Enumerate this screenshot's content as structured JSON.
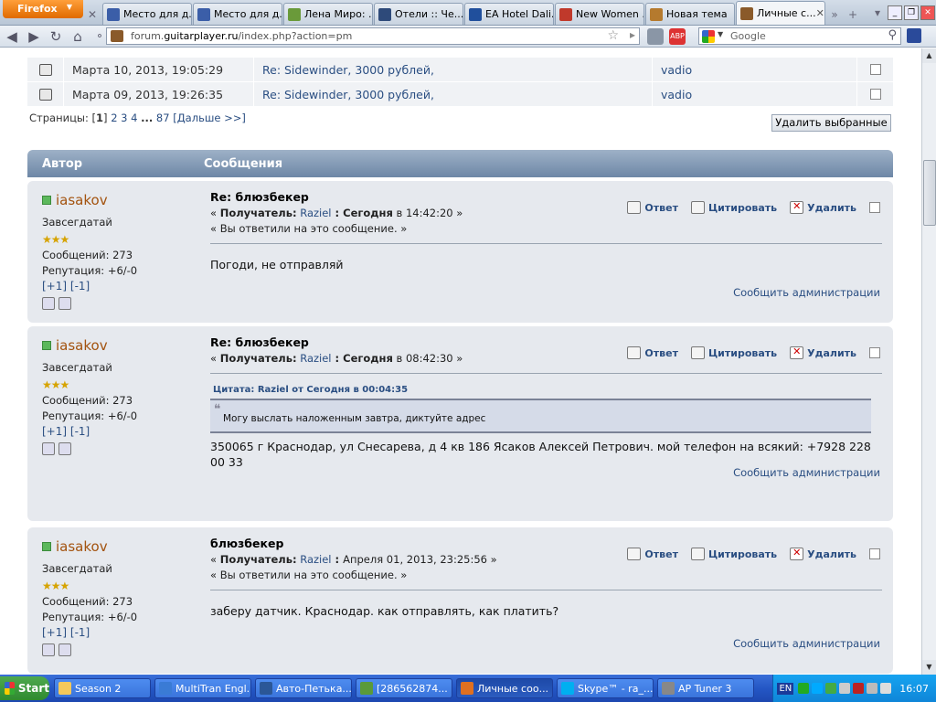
{
  "browser": {
    "app_label": "Firefox",
    "tabs": [
      {
        "label": "Место для д...",
        "color": "#3b5ea8"
      },
      {
        "label": "Место для д...",
        "color": "#3b5ea8"
      },
      {
        "label": "Лена Миро: ...",
        "color": "#6a9a3a"
      },
      {
        "label": "Отели :: Че...",
        "color": "#2e4a7a"
      },
      {
        "label": "EA Hotel Dali...",
        "color": "#204f9c"
      },
      {
        "label": "New Women ...",
        "color": "#c0392b"
      },
      {
        "label": "Новая тема",
        "color": "#b57a2e"
      },
      {
        "label": "Личные с...",
        "color": "#8a5a2a",
        "active": true
      }
    ],
    "url_prefix": "forum.",
    "url_domain": "guitarplayer.ru",
    "url_path": "/index.php?action=pm",
    "search_placeholder": "Google"
  },
  "pm_rows": [
    {
      "date": "Марта 10, 2013, 19:05:29",
      "subject": "Re: Sidewinder, 3000 рублей,",
      "author": "vadio"
    },
    {
      "date": "Марта 09, 2013, 19:26:35",
      "subject": "Re: Sidewinder, 3000 рублей,",
      "author": "vadio"
    }
  ],
  "pager": {
    "prefix": "Страницы:",
    "current": "1",
    "pages": [
      "2",
      "3",
      "4"
    ],
    "ellipsis": "...",
    "last": "87",
    "next": "[Дальше >>]"
  },
  "delete_selected": "Удалить выбранные",
  "table_header": {
    "author": "Автор",
    "messages": "Сообщения"
  },
  "actions": {
    "reply": "Ответ",
    "quote": "Цитировать",
    "delete": "Удалить"
  },
  "report_text": "Сообщить администрации",
  "posts": [
    {
      "author": "iasakov",
      "rank": "Завсегдатай",
      "stars": "★★★",
      "messages": "Сообщений: 273",
      "reputation": "Репутация: +6/-0",
      "rep_plus": "[+1]",
      "rep_minus": "[-1]",
      "title": "Re: блюзбекер",
      "meta_open": "« ",
      "recipient_label": "Получатель:",
      "recipient": "Raziel",
      "sep": " : ",
      "date_bold": "Сегодня",
      "date_rest": " в 14:42:20 »",
      "replied": "« Вы ответили на это сообщение. »",
      "text": "Погоди, не отправляй"
    },
    {
      "author": "iasakov",
      "rank": "Завсегдатай",
      "stars": "★★★",
      "messages": "Сообщений: 273",
      "reputation": "Репутация: +6/-0",
      "rep_plus": "[+1]",
      "rep_minus": "[-1]",
      "title": "Re: блюзбекер",
      "meta_open": "« ",
      "recipient_label": "Получатель:",
      "recipient": "Raziel",
      "sep": " : ",
      "date_bold": "Сегодня",
      "date_rest": " в 08:42:30 »",
      "quote_header": "Цитата: Raziel от Сегодня в 00:04:35",
      "quote_text": "Могу выслать наложенным завтра, диктуйте адрес",
      "text": "350065 г Краснодар, ул Снесарева, д 4 кв 186 Ясаков Алексей Петрович. мой телефон на всякий: +7928 228 00 33"
    },
    {
      "author": "iasakov",
      "rank": "Завсегдатай",
      "stars": "★★★",
      "messages": "Сообщений: 273",
      "reputation": "Репутация: +6/-0",
      "rep_plus": "[+1]",
      "rep_minus": "[-1]",
      "title": "блюзбекер",
      "meta_open": "« ",
      "recipient_label": "Получатель:",
      "recipient": "Raziel",
      "sep": " : ",
      "date_bold": "",
      "date_rest": "Апреля 01, 2013, 23:25:56 »",
      "replied": "« Вы ответили на это сообщение. »",
      "text": "заберу датчик. Краснодар. как отправлять, как платить?"
    }
  ],
  "taskbar": {
    "start": "Start",
    "tasks": [
      "Season 2",
      "MultiTran Engl...",
      "Авто-Петька....",
      "[286562874...",
      "Личные соо...",
      "Skype™ - ra_...",
      "AP Tuner 3"
    ],
    "active_index": 4,
    "lang": "EN",
    "clock": "16:07"
  }
}
